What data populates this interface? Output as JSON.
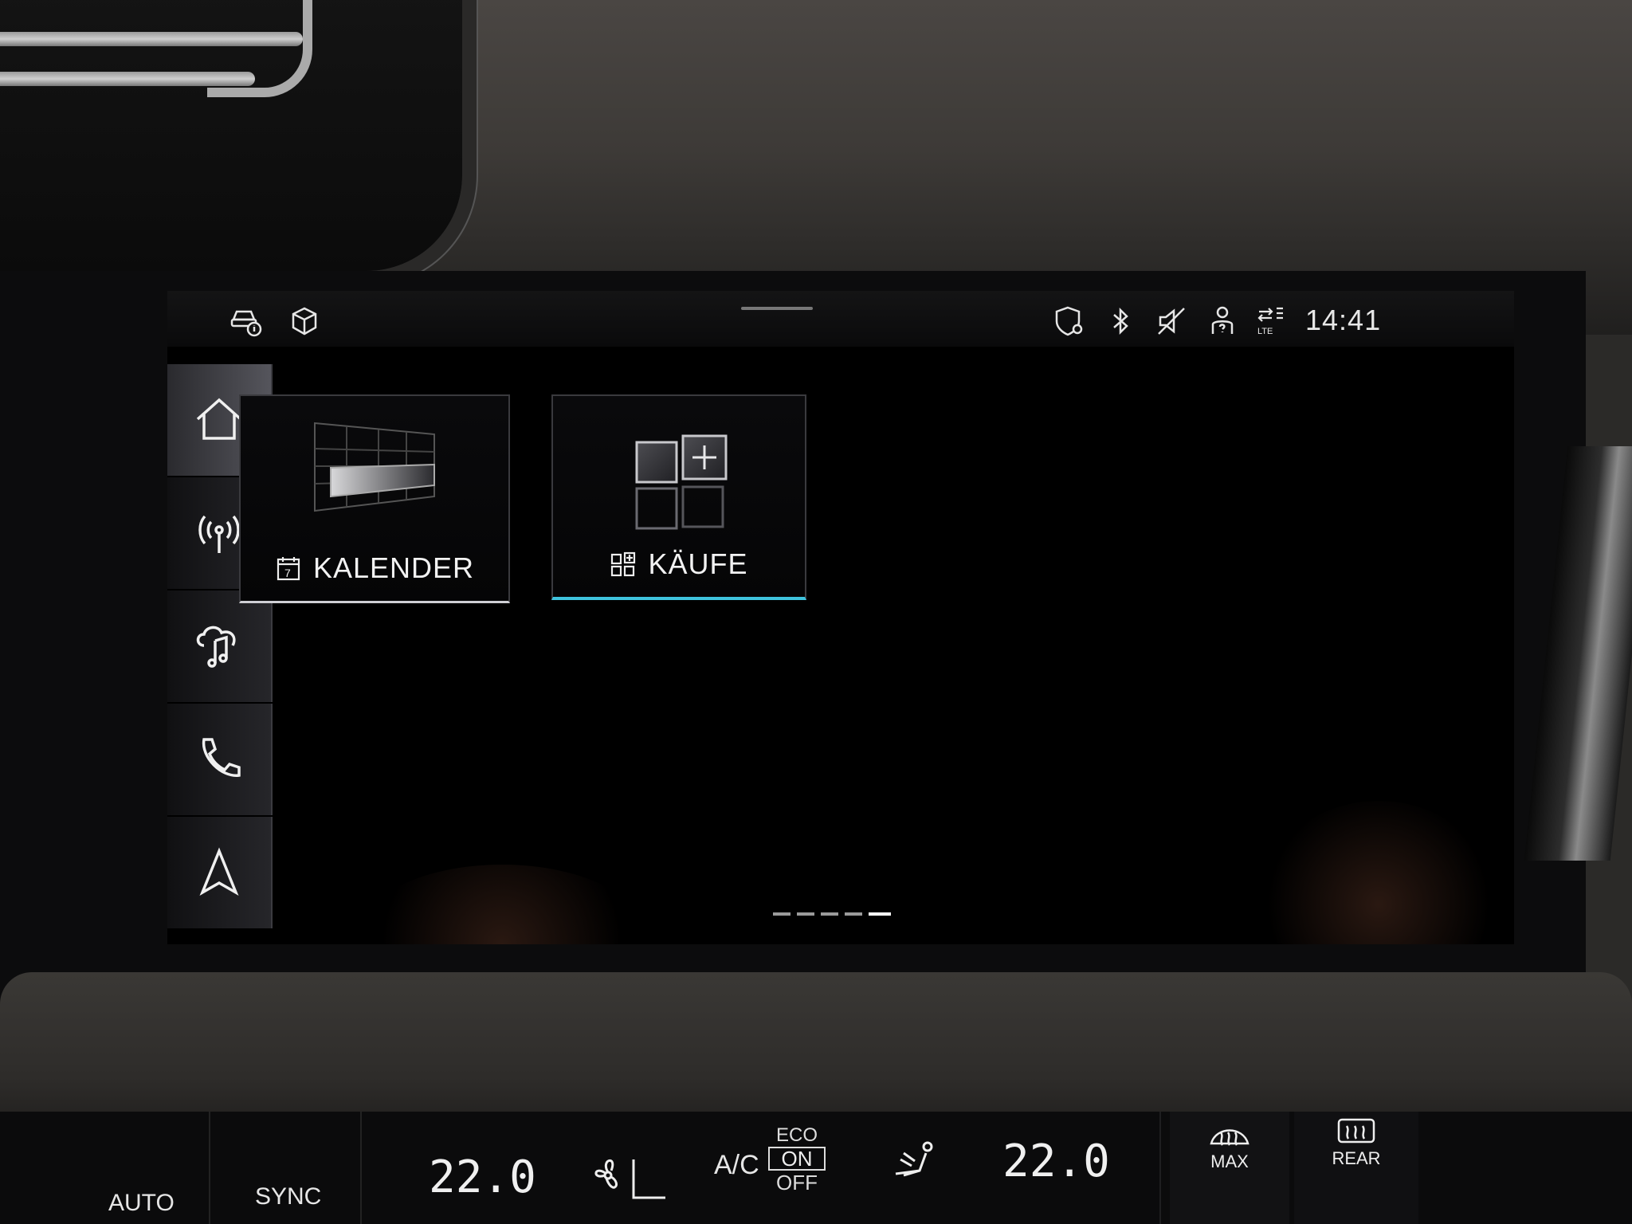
{
  "status_bar": {
    "time": "14:41",
    "left_icons": [
      "car-info-icon",
      "package-icon"
    ],
    "right_icons": [
      "shield-location-icon",
      "bluetooth-icon",
      "mute-icon",
      "person-help-icon",
      "lte-data-icon"
    ]
  },
  "sidebar": {
    "items": [
      {
        "icon": "home-icon",
        "active": true
      },
      {
        "icon": "radio-icon"
      },
      {
        "icon": "media-cloud-icon"
      },
      {
        "icon": "phone-icon"
      },
      {
        "icon": "navigation-icon"
      }
    ]
  },
  "tiles": [
    {
      "label": "KALENDER",
      "icon": "calendar-icon",
      "calendar_day": "7"
    },
    {
      "label": "KÄUFE",
      "icon": "apps-icon"
    }
  ],
  "pager": {
    "count": 5,
    "active_index": 4
  },
  "climate": {
    "left_buttons": [
      "AUTO",
      "SYNC"
    ],
    "left_temp": "22.0",
    "right_temp": "22.0",
    "ac_label": "A/C",
    "eco_label": "ECO",
    "on_label": "ON",
    "off_label": "OFF",
    "max_label": "MAX",
    "rear_label": "REAR"
  }
}
